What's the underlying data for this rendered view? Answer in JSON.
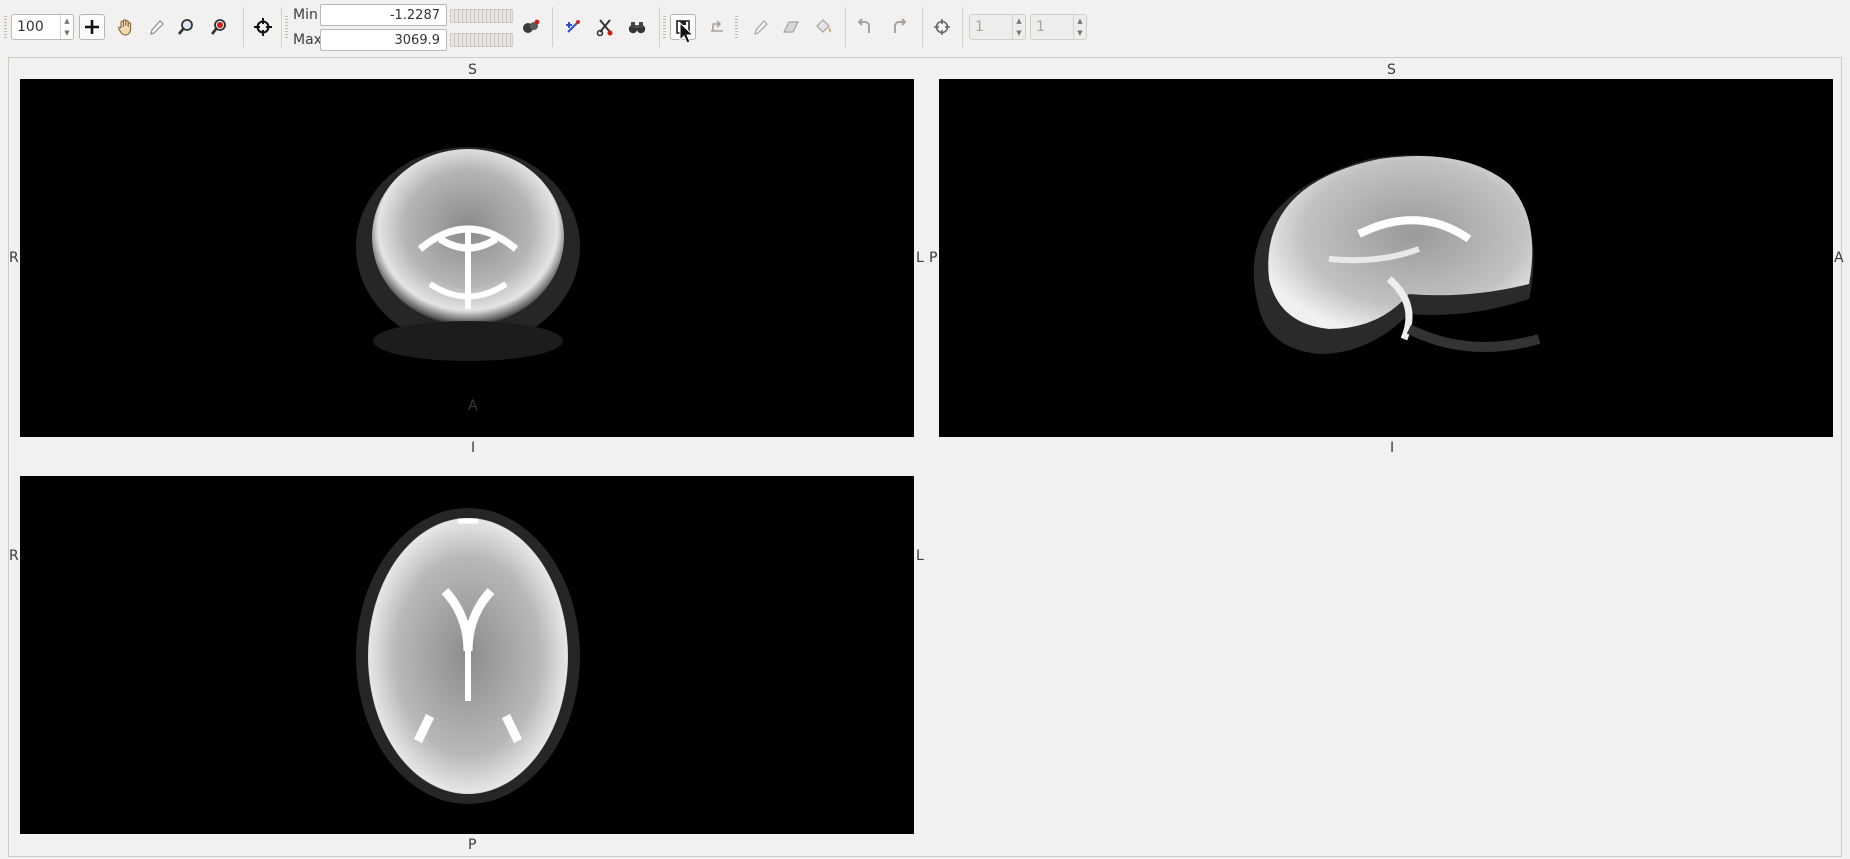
{
  "toolbar": {
    "zoom_value": "100",
    "min_label": "Min",
    "min_value": "-1.2287",
    "max_label": "Max",
    "max_value": "3069.9",
    "volume_value": "1",
    "frame_value": "1",
    "zoom_range": [
      0,
      1000
    ]
  },
  "views": {
    "coronal": {
      "top": "S",
      "bottom": "I",
      "left": "R",
      "right": "L"
    },
    "sagittal": {
      "top": "S",
      "bottom": "I",
      "left": "P",
      "right": "A"
    },
    "axial": {
      "top": "A",
      "bottom": "P",
      "left": "R",
      "right": "L"
    }
  },
  "icons": [
    "crosshair-plus-icon",
    "hand-pan-icon",
    "pencil-icon",
    "zoom-in-icon",
    "zoom-out-icon",
    "center-cursor-icon",
    "colorize-icon",
    "add-point-icon",
    "cut-icon",
    "binoculars-icon",
    "save-icon",
    "rotate-icon",
    "edit-pencil-icon",
    "eraser-icon",
    "fill-bucket-icon",
    "undo-icon",
    "redo-icon",
    "target-icon"
  ]
}
